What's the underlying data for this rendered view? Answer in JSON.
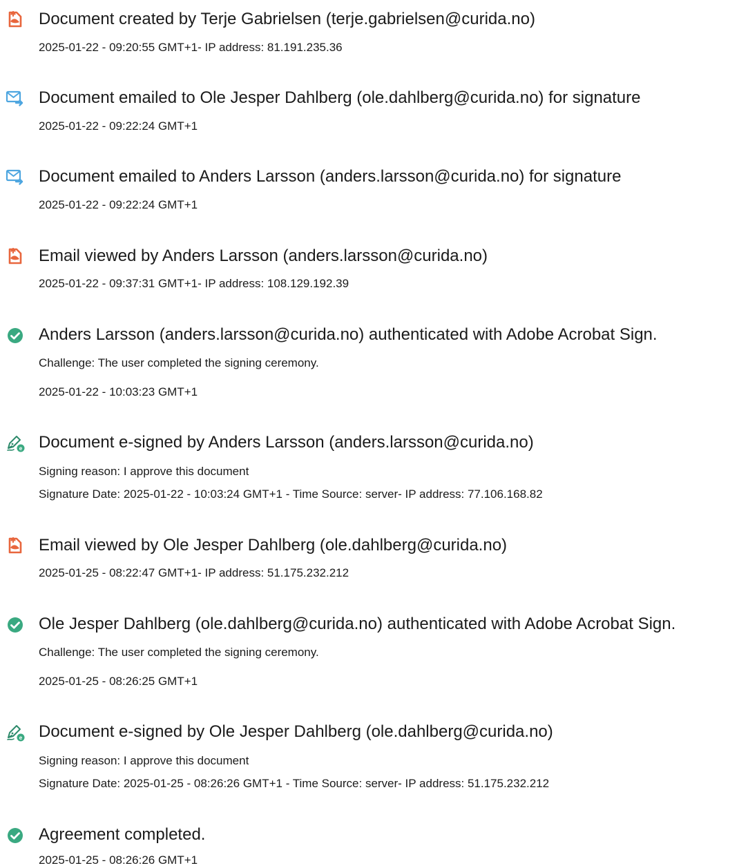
{
  "events": [
    {
      "icon": "acrobat-document-icon",
      "title": "Document created by Terje Gabrielsen (terje.gabrielsen@curida.no)",
      "lines": [
        "2025-01-22 - 09:20:55 GMT+1- IP address: 81.191.235.36"
      ]
    },
    {
      "icon": "email-sent-icon",
      "title": "Document emailed to Ole Jesper Dahlberg (ole.dahlberg@curida.no) for signature",
      "lines": [
        "2025-01-22 - 09:22:24 GMT+1"
      ]
    },
    {
      "icon": "email-sent-icon",
      "title": "Document emailed to Anders Larsson (anders.larsson@curida.no) for signature",
      "lines": [
        "2025-01-22 - 09:22:24 GMT+1"
      ]
    },
    {
      "icon": "acrobat-document-icon",
      "title": "Email viewed by Anders Larsson (anders.larsson@curida.no)",
      "lines": [
        "2025-01-22 - 09:37:31 GMT+1- IP address: 108.129.192.39"
      ]
    },
    {
      "icon": "check-circle-icon",
      "title": "Anders Larsson (anders.larsson@curida.no) authenticated with Adobe Acrobat Sign.",
      "lines": [
        "Challenge: The user completed the signing ceremony.",
        "2025-01-22 - 10:03:23 GMT+1"
      ]
    },
    {
      "icon": "pen-signature-icon",
      "title": "Document e-signed by Anders Larsson (anders.larsson@curida.no)",
      "lines": [
        "Signing reason: I approve this document",
        "Signature Date: 2025-01-22 - 10:03:24 GMT+1 - Time Source: server- IP address: 77.106.168.82"
      ]
    },
    {
      "icon": "acrobat-document-icon",
      "title": "Email viewed by Ole Jesper Dahlberg (ole.dahlberg@curida.no)",
      "lines": [
        "2025-01-25 - 08:22:47 GMT+1- IP address: 51.175.232.212"
      ]
    },
    {
      "icon": "check-circle-icon",
      "title": "Ole Jesper Dahlberg (ole.dahlberg@curida.no) authenticated with Adobe Acrobat Sign.",
      "lines": [
        "Challenge: The user completed the signing ceremony.",
        "2025-01-25 - 08:26:25 GMT+1"
      ]
    },
    {
      "icon": "pen-signature-icon",
      "title": "Document e-signed by Ole Jesper Dahlberg (ole.dahlberg@curida.no)",
      "lines": [
        "Signing reason: I approve this document",
        "Signature Date: 2025-01-25 - 08:26:26 GMT+1 - Time Source: server- IP address: 51.175.232.212"
      ]
    },
    {
      "icon": "check-circle-icon",
      "title": "Agreement completed.",
      "lines": [
        "2025-01-25 - 08:26:26 GMT+1"
      ]
    }
  ],
  "colors": {
    "acrobat": "#e8663d",
    "email": "#4ea6e0",
    "check": "#3aa981",
    "pen": "#2d8a6b"
  }
}
